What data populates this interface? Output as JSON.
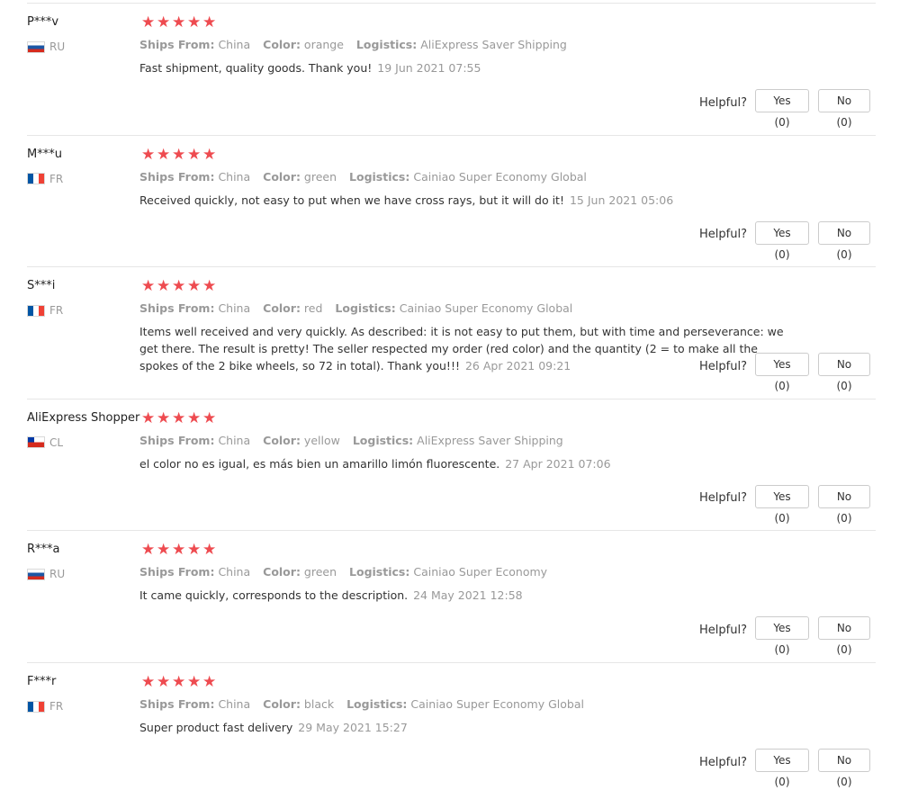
{
  "labels": {
    "ships_from": "Ships From:",
    "color": "Color:",
    "logistics": "Logistics:",
    "helpful": "Helpful?"
  },
  "flags": {
    "RU": [
      "#ffffff",
      "#1c57a5",
      "#d52b1e"
    ],
    "FR": [
      "#0055a4",
      "#ffffff",
      "#ef4135"
    ],
    "CL": [
      "#0039a6",
      "#ffffff",
      "#d52b1e"
    ]
  },
  "star_color": "#ee4b50",
  "reviews": [
    {
      "user": "P***v",
      "country": "RU",
      "rating": 5,
      "ships_from": "China",
      "color": "orange",
      "logistics": "AliExpress Saver Shipping",
      "text": "Fast shipment, quality goods. Thank you!",
      "date": "19 Jun 2021 07:55",
      "yes": "Yes (0)",
      "no": "No (0)"
    },
    {
      "user": "M***u",
      "country": "FR",
      "rating": 5,
      "ships_from": "China",
      "color": "green",
      "logistics": "Cainiao Super Economy Global",
      "text": "Received quickly, not easy to put when we have cross rays, but it will do it!",
      "date": "15 Jun 2021 05:06",
      "yes": "Yes (0)",
      "no": "No (0)"
    },
    {
      "user": "S***i",
      "country": "FR",
      "rating": 5,
      "ships_from": "China",
      "color": "red",
      "logistics": "Cainiao Super Economy Global",
      "text": "Items well received and very quickly. As described: it is not easy to put them, but with time and perseverance: we get there. The result is pretty! The seller respected my order (red color) and the quantity (2 = to make all the spokes of the 2 bike wheels, so 72 in total). Thank you!!!",
      "date": "26 Apr 2021 09:21",
      "yes": "Yes (0)",
      "no": "No (0)"
    },
    {
      "user": "AliExpress Shopper",
      "country": "CL",
      "rating": 5,
      "ships_from": "China",
      "color": "yellow",
      "logistics": "AliExpress Saver Shipping",
      "text": "el color no es igual, es más bien un amarillo limón fluorescente.",
      "date": "27 Apr 2021 07:06",
      "yes": "Yes (0)",
      "no": "No (0)"
    },
    {
      "user": "R***a",
      "country": "RU",
      "rating": 5,
      "ships_from": "China",
      "color": "green",
      "logistics": "Cainiao Super Economy",
      "text": "It came quickly, corresponds to the description.",
      "date": "24 May 2021 12:58",
      "yes": "Yes (0)",
      "no": "No (0)"
    },
    {
      "user": "F***r",
      "country": "FR",
      "rating": 5,
      "ships_from": "China",
      "color": "black",
      "logistics": "Cainiao Super Economy Global",
      "text": "Super product fast delivery",
      "date": "29 May 2021 15:27",
      "yes": "Yes (0)",
      "no": "No (0)"
    }
  ]
}
